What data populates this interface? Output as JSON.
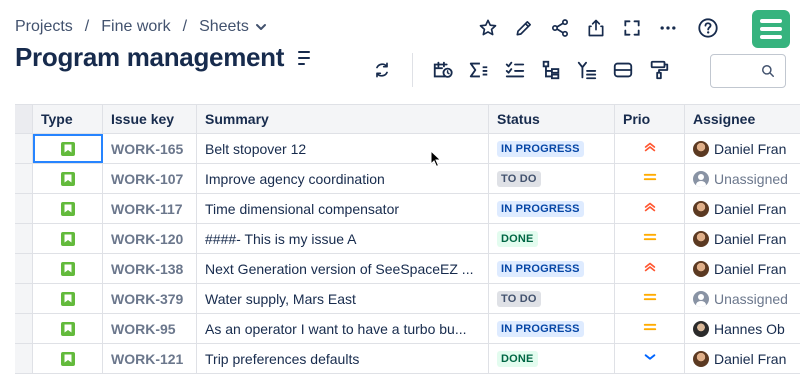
{
  "breadcrumb": {
    "items": [
      "Projects",
      "Fine work",
      "Sheets"
    ],
    "separator": "/"
  },
  "page": {
    "title": "Program management"
  },
  "top_icons": [
    "star-icon",
    "pencil-icon",
    "share-icon",
    "export-icon",
    "fullscreen-icon",
    "more-icon",
    "help-icon"
  ],
  "toolbar_icons": [
    "refresh-icon",
    "calendar-icon",
    "sum-icon",
    "checklist-icon",
    "hierarchy-icon",
    "filter-list-icon",
    "group-icon",
    "format-paint-icon"
  ],
  "search": {
    "placeholder": ""
  },
  "colors": {
    "brand": "#36b37e",
    "in_progress_bg": "#deebff",
    "in_progress_fg": "#0747a6",
    "todo_bg": "#dfe1e6",
    "done_bg": "#e3fcef",
    "prio_high": "#ff5630",
    "prio_medium": "#ffab00",
    "prio_low": "#0065ff"
  },
  "table": {
    "headers": {
      "type": "Type",
      "key": "Issue key",
      "summary": "Summary",
      "status": "Status",
      "prio": "Prio",
      "assignee": "Assignee"
    },
    "rows": [
      {
        "key": "WORK-165",
        "summary": "Belt stopover 12",
        "status": "IN PROGRESS",
        "status_kind": "inprogress",
        "prio": "high",
        "assignee": "Daniel Fran",
        "avatar": "daniel"
      },
      {
        "key": "WORK-107",
        "summary": "Improve agency coordination",
        "status": "TO DO",
        "status_kind": "todo",
        "prio": "medium",
        "assignee": "Unassigned",
        "avatar": "unassigned"
      },
      {
        "key": "WORK-117",
        "summary": "Time dimensional compensator",
        "status": "IN PROGRESS",
        "status_kind": "inprogress",
        "prio": "high",
        "assignee": "Daniel Fran",
        "avatar": "daniel"
      },
      {
        "key": "WORK-120",
        "summary": "####- This is my issue A",
        "status": "DONE",
        "status_kind": "done",
        "prio": "medium",
        "assignee": "Daniel Fran",
        "avatar": "daniel"
      },
      {
        "key": "WORK-138",
        "summary": "Next Generation version of SeeSpaceEZ ...",
        "status": "IN PROGRESS",
        "status_kind": "inprogress",
        "prio": "high",
        "assignee": "Daniel Fran",
        "avatar": "daniel"
      },
      {
        "key": "WORK-379",
        "summary": "Water supply, Mars East",
        "status": "TO DO",
        "status_kind": "todo",
        "prio": "medium",
        "assignee": "Unassigned",
        "avatar": "unassigned"
      },
      {
        "key": "WORK-95",
        "summary": "As an operator I want to have a turbo bu...",
        "status": "IN PROGRESS",
        "status_kind": "inprogress",
        "prio": "medium",
        "assignee": "Hannes Ob",
        "avatar": "hannes"
      },
      {
        "key": "WORK-121",
        "summary": "Trip preferences defaults",
        "status": "DONE",
        "status_kind": "done",
        "prio": "low",
        "assignee": "Daniel Fran",
        "avatar": "daniel"
      }
    ]
  }
}
